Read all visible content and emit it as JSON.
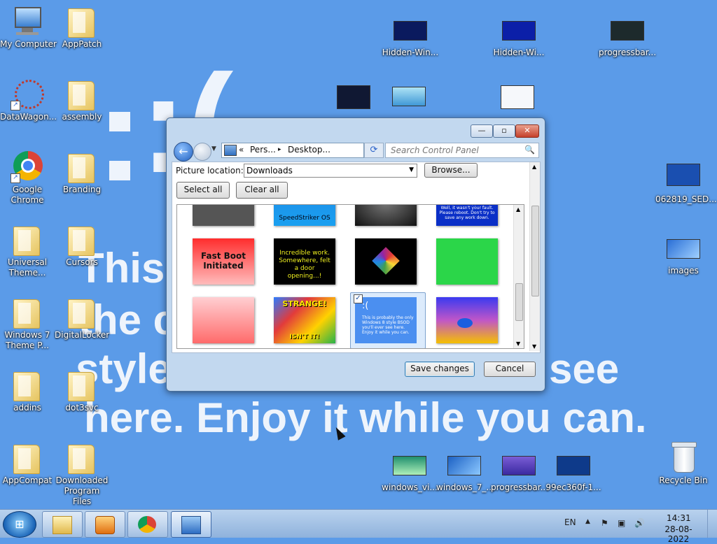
{
  "wallpaper": {
    "frown": ":(",
    "line1": "This",
    "line2": "the c",
    "line3": "style",
    "line3b": "see",
    "line4": "here. Enjoy it while you can."
  },
  "desktop_icons": {
    "my_computer": "My Computer",
    "apppatch": "AppPatch",
    "datawagon": "DataWagon...",
    "assembly": "assembly",
    "google_chrome": "Google Chrome",
    "branding": "Branding",
    "universal_theme": "Universal Theme...",
    "cursors": "Cursors",
    "win7_theme": "Windows 7 Theme P...",
    "digitallocker": "DigitalLocker",
    "addins": "addins",
    "dot3svc": "dot3svc",
    "appcompat": "AppCompat",
    "downloaded": "Downloaded Program Files",
    "hidden_win_1": "Hidden-Win...",
    "hidden_win_2": "Hidden-Wi...",
    "progressbar_1": "progressbar...",
    "file_062819": "062819_SED...",
    "images": "images",
    "windows_vi": "windows_vi...",
    "windows_7": "windows_7_...",
    "progressbar_2": "progressbar...",
    "file_99ec": "99ec360f-1...",
    "recycle_bin": "Recycle Bin"
  },
  "dialog": {
    "caption_min": "—",
    "caption_max": "▫",
    "caption_close": "✕",
    "address": {
      "chevron": "«",
      "seg1": "Pers...",
      "sep": "▸",
      "seg2": "Desktop..."
    },
    "search_placeholder": "Search Control Panel",
    "picture_location_label": "Picture location:",
    "picture_location_value": "Downloads",
    "browse_label": "Browse...",
    "select_all_label": "Select all",
    "clear_all_label": "Clear all",
    "tiles": {
      "speedstriker": "SpeedStriker OS",
      "what_happened": "Huh, what happened? Well, it wasn't your fault. Please reboot. Don't try to save any work down.",
      "fast_boot": "Fast Boot Initiated",
      "incredible": "Incredible work. Somewhere, felt a door opening...!",
      "strange_top": "STRANGE!",
      "strange_bottom": "ISN'T IT!",
      "sad_face": ":(",
      "sad_text": "This is probably the only Windows 8 style BSOD you'll ever see here. Enjoy it while you can."
    },
    "save_label": "Save changes",
    "cancel_label": "Cancel"
  },
  "taskbar": {
    "lang": "EN",
    "time": "14:31",
    "date": "28-08-2022"
  },
  "colors": {
    "desktop_bg": "#5b9be8",
    "dialog_frame": "#c2d8ef",
    "selected_tile": "#dcebfc"
  }
}
